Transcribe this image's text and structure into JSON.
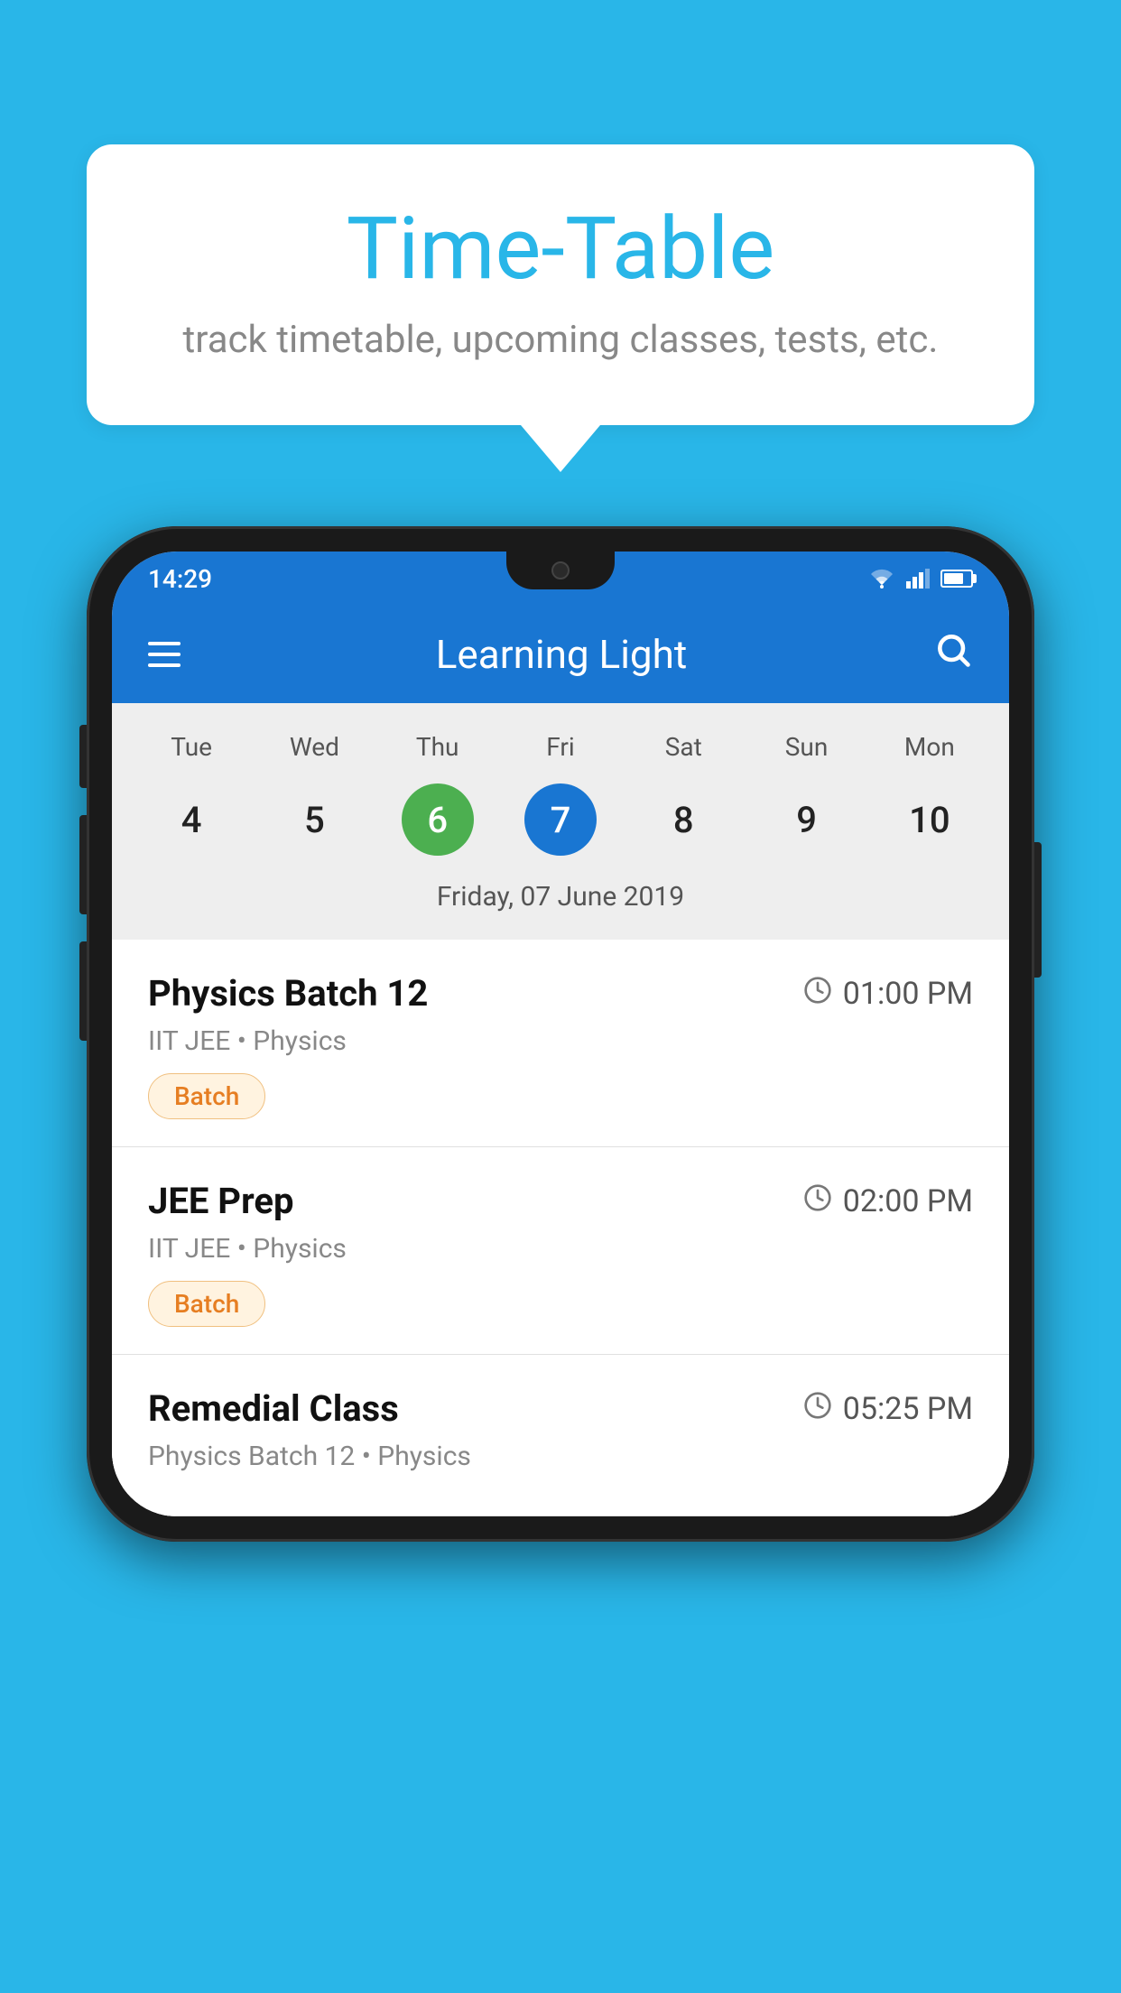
{
  "background_color": "#29b6e8",
  "tooltip": {
    "title": "Time-Table",
    "subtitle": "track timetable, upcoming classes, tests, etc."
  },
  "phone": {
    "status_bar": {
      "time": "14:29"
    },
    "app_bar": {
      "title": "Learning Light"
    },
    "calendar": {
      "days": [
        "Tue",
        "Wed",
        "Thu",
        "Fri",
        "Sat",
        "Sun",
        "Mon"
      ],
      "dates": [
        "4",
        "5",
        "6",
        "7",
        "8",
        "9",
        "10"
      ],
      "today_index": 2,
      "selected_index": 3,
      "selected_date_label": "Friday, 07 June 2019"
    },
    "schedule": [
      {
        "title": "Physics Batch 12",
        "time": "01:00 PM",
        "meta": "IIT JEE • Physics",
        "badge": "Batch"
      },
      {
        "title": "JEE Prep",
        "time": "02:00 PM",
        "meta": "IIT JEE • Physics",
        "badge": "Batch"
      },
      {
        "title": "Remedial Class",
        "time": "05:25 PM",
        "meta": "Physics Batch 12 • Physics",
        "badge": ""
      }
    ]
  }
}
